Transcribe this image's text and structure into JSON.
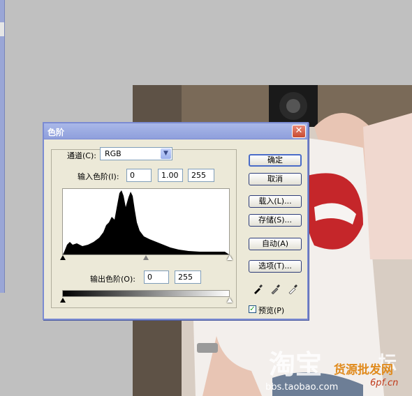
{
  "dialog": {
    "title": "色阶",
    "close_glyph": "✕",
    "channel_label": "通道(C):",
    "channel_value": "RGB",
    "input_label": "输入色阶(I):",
    "input_black": "0",
    "input_gamma": "1.00",
    "input_white": "255",
    "output_label": "输出色阶(O):",
    "output_black": "0",
    "output_white": "255",
    "buttons": {
      "ok": "确定",
      "cancel": "取消",
      "load": "载入(L)...",
      "save": "存储(S)...",
      "auto": "自动(A)",
      "options": "选项(T)..."
    },
    "preview_label": "预览(P)",
    "preview_checked": true,
    "eyedroppers": [
      "black-eyedropper-icon",
      "gray-eyedropper-icon",
      "white-eyedropper-icon"
    ]
  },
  "watermark": {
    "logo_text": "淘宝",
    "forum_char": "坛",
    "site_url": "bbs.taobao.com",
    "overlay_text": "货源批发网",
    "overlay_url": "6pf.cn"
  },
  "colors": {
    "dialog_bg": "#ece9d8",
    "titlebar": "#8f9fdc",
    "canvas_bg": "#c0c0c0"
  }
}
